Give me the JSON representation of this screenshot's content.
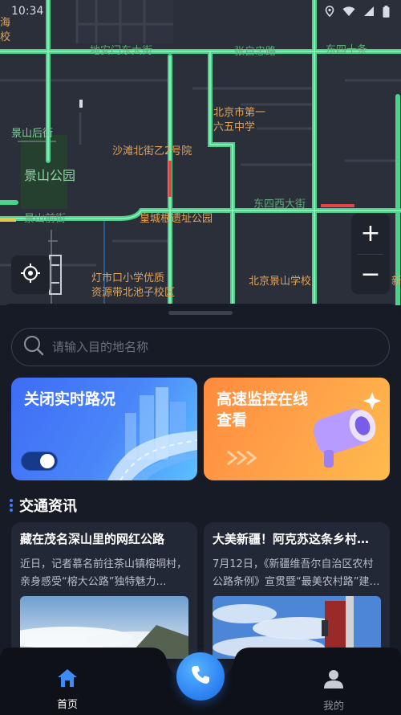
{
  "status_bar": {
    "time": "10:34"
  },
  "map": {
    "labels": {
      "hai": "海",
      "xiao": "校",
      "road_1": "地安门东大街",
      "road_2": "张自忠路",
      "road_3": "东四十条",
      "jingshan_houjie": "景山后街",
      "school_1a": "北京市第一",
      "school_1b": "六五中学",
      "shatan": "沙滩北街乙2号院",
      "jingshan_park": "景山公园",
      "dongsi_xi": "东四西大街",
      "jingshan_qianjie": "景山前街",
      "huangcheng": "皇城根遗址公园",
      "dengshikou_a": "灯市口小学优质",
      "dengshikou_b": "资源带北池子校区",
      "jingshan_school": "北京景山学校",
      "edge_right": "新"
    },
    "zoom_in": "+",
    "zoom_out": "−"
  },
  "search": {
    "placeholder": "请输入目的地名称"
  },
  "cards": [
    {
      "title": "关闭实时路况",
      "toggle_on": true,
      "color": "#4a86f8"
    },
    {
      "title": "高速监控在线查看",
      "color": "#ffa24a"
    }
  ],
  "section": {
    "title": "交通资讯"
  },
  "news": [
    {
      "title": "藏在茂名深山里的网红公路",
      "body": "近日，记者慕名前往茶山镇榕垌村，亲身感受“榕大公路”独特魅力…"
    },
    {
      "title": "大美新疆！阿克苏这条乡村…",
      "body": "7月12日，《新疆维吾尔自治区农村公路条例》宣贯暨“最美农村路”建…"
    }
  ],
  "nav": {
    "home_label": "首页",
    "me_label": "我的"
  }
}
